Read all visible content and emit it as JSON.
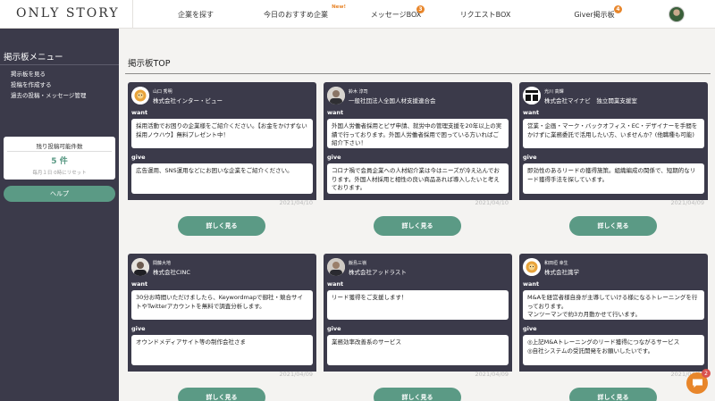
{
  "header": {
    "logo": "ONLY STORY",
    "nav": [
      {
        "label": "企業を探す"
      },
      {
        "label": "今日のおすすめ企業",
        "new_label": "New!"
      },
      {
        "label": "メッセージBOX",
        "badge": "3"
      },
      {
        "label": "リクエストBOX"
      },
      {
        "label": "Giver掲示板",
        "badge": "4"
      }
    ]
  },
  "sidebar": {
    "title": "掲示板メニュー",
    "links": [
      "掲示板を見る",
      "投稿を作成する",
      "過去の投稿・メッセージ管理"
    ],
    "remaining_label": "残り投稿可能件数",
    "remaining_count": "5",
    "remaining_unit": "件",
    "reset_note": "毎月１日 0時にリセット",
    "help_label": "ヘルプ"
  },
  "main": {
    "title": "掲示板TOP",
    "want_label": "want",
    "give_label": "give",
    "detail_label": "詳しく見る",
    "cards": [
      {
        "user": "山口 秀明",
        "company": "株式会社インター・ビュー",
        "want": "採用活動でお困りの企業様をご紹介ください。【お金をかけずない採用ノウハウ】無料プレゼント中！",
        "give": "広告運用、SNS運用などにお困いな企業をご紹介ください。",
        "date": "2021/04/10",
        "avatar": "lion-logo-icon"
      },
      {
        "user": "鈴木 淳司",
        "company": "一般社団法人全国人材支援連合会",
        "want": "外国人労働者採用とビザ申請、就労中の管理支援を20年以上の実績で行っております。外国人労働者採用で困っている方いればご紹介下さい！",
        "give": "コロナ禍で会員企業への人材紹介業は今はニーズが冷え込んでおります。外国人材採用と相性の良い商品あれば導入したいと考えております。",
        "date": "2021/04/10",
        "avatar": "person-photo-icon"
      },
      {
        "user": "光川 高輝",
        "company": "株式会社マイナビ　独立開業支援室",
        "want": "営業・企画・マーク・バックオフィス・EC・デザイナーを手間をかけずに業務委託で活用したい方、いませんか？(他職種も可能)",
        "give": "即効性のあるリードの獲得施策。組織編成の関係で、短期的なリード獲得手法を探しています。",
        "date": "2021/04/09",
        "avatar": "logo-text-icon"
      },
      {
        "user": "間藤大地",
        "company": "株式会社CINC",
        "want": "30分お時間いただけましたら、Keywordmapで御社・競合サイトやTwitterアカウントを無料で調査分析します。",
        "give": "オウンドメディアサイト等の制作会社さま",
        "date": "2021/04/09",
        "avatar": "person-photo-icon"
      },
      {
        "user": "飯島三嶺",
        "company": "株式会社アッドラスト",
        "want": "リード獲得をご支援します！",
        "give": "業務効率改善系のサービス",
        "date": "2021/04/09",
        "avatar": "person-photo-icon"
      },
      {
        "user": "和田垣 幸生",
        "company": "株式会社識学",
        "want": "M&Aを経営者様自身が主導していける様になるトレーニングを行っております。\nマンツーマンで約3カ月動かせて行います。",
        "give": "◎上記M&Aトレーニングのリード獲得につながるサービス\n◎自社システムの受託開発をお願いしたいです。",
        "date": "2021/04/09",
        "avatar": "lion-logo-icon"
      }
    ]
  },
  "chat": {
    "badge": "2"
  },
  "colors": {
    "accent": "#5b9a85",
    "dark": "#3b3a4a",
    "orange": "#e8862b"
  }
}
